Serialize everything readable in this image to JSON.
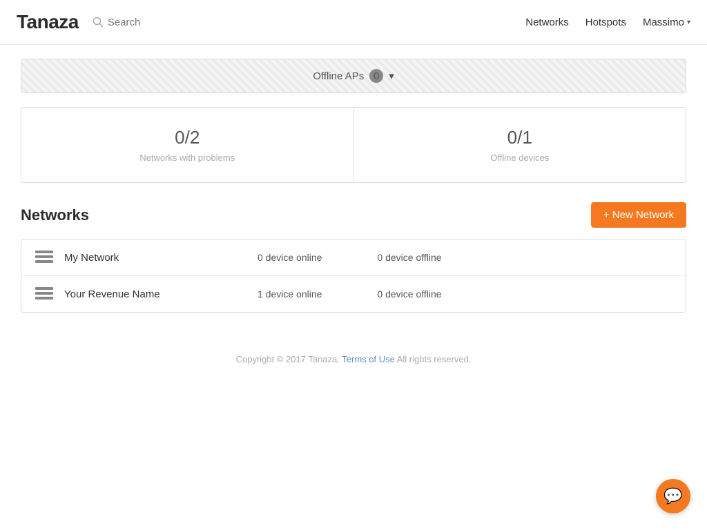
{
  "header": {
    "logo": "Tanaza",
    "search_placeholder": "Search",
    "nav": {
      "networks": "Networks",
      "hotspots": "Hotspots",
      "user": "Massimo"
    }
  },
  "offline_bar": {
    "label": "Offline APs",
    "count": "0"
  },
  "stats": {
    "networks_problems": {
      "value": "0/2",
      "label": "Networks with problems"
    },
    "offline_devices": {
      "value": "0/1",
      "label": "Offline devices"
    }
  },
  "networks_section": {
    "title": "Networks",
    "new_button": "+ New Network",
    "rows": [
      {
        "name": "My Network",
        "online": "0 device online",
        "offline": "0 device offline"
      },
      {
        "name": "Your Revenue Name",
        "online": "1 device online",
        "offline": "0 device offline"
      }
    ]
  },
  "footer": {
    "text": "Copyright © 2017 Tanaza.",
    "link_text": "Terms of Use",
    "suffix": " All rights reserved."
  },
  "chat": {
    "icon": "💬"
  }
}
